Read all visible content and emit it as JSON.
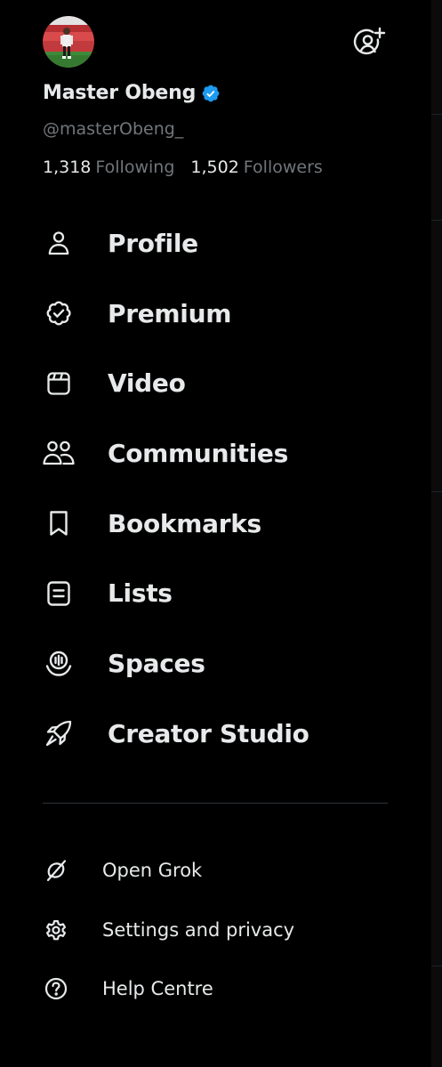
{
  "profile": {
    "display_name": "Master Obeng",
    "handle": "@masterObeng_",
    "verified": true,
    "following_count": "1,318",
    "following_label": "Following",
    "followers_count": "1,502",
    "followers_label": "Followers"
  },
  "menu": {
    "items": [
      {
        "label": "Profile",
        "icon": "person-icon"
      },
      {
        "label": "Premium",
        "icon": "premium-badge-icon"
      },
      {
        "label": "Video",
        "icon": "video-icon"
      },
      {
        "label": "Communities",
        "icon": "communities-icon"
      },
      {
        "label": "Bookmarks",
        "icon": "bookmark-icon"
      },
      {
        "label": "Lists",
        "icon": "list-icon"
      },
      {
        "label": "Spaces",
        "icon": "spaces-icon"
      },
      {
        "label": "Creator Studio",
        "icon": "rocket-icon"
      }
    ]
  },
  "secondary": {
    "items": [
      {
        "label": "Open Grok",
        "icon": "grok-icon"
      },
      {
        "label": "Settings and privacy",
        "icon": "gear-icon"
      },
      {
        "label": "Help Centre",
        "icon": "help-icon"
      }
    ]
  },
  "colors": {
    "background": "#000000",
    "text_primary": "#e7e9ea",
    "text_secondary": "#71767b",
    "verified_blue": "#1d9bf0",
    "divider": "#2f3336"
  }
}
